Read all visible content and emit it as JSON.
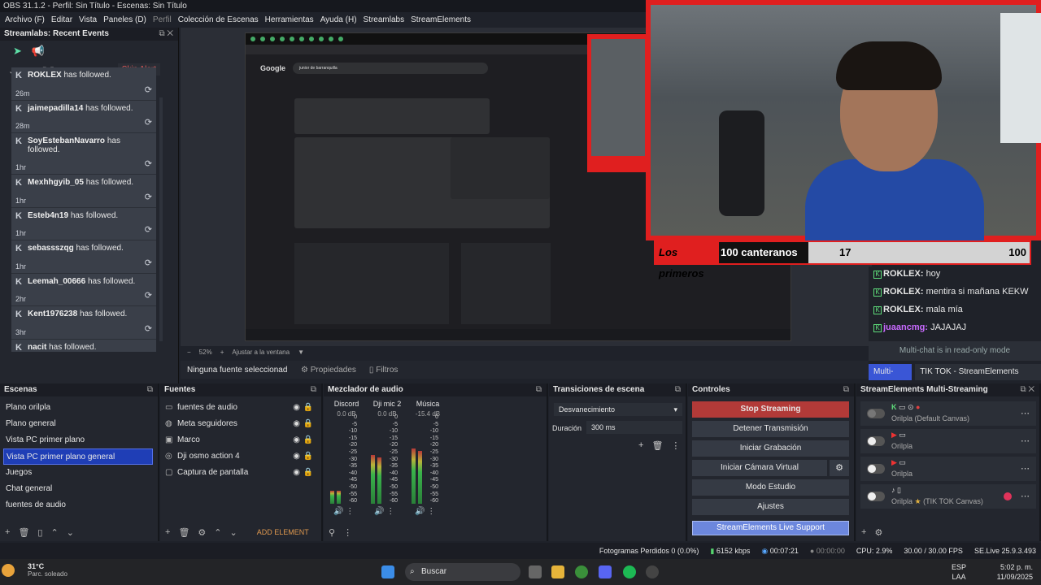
{
  "window": {
    "title": "OBS 31.1.2 - Perfil: Sin Título - Escenas: Sin Título"
  },
  "menu": [
    "Archivo (F)",
    "Editar",
    "Vista",
    "Paneles (D)",
    "Perfil",
    "Colección de Escenas",
    "Herramientas",
    "Ayuda (H)",
    "Streamlabs",
    "StreamElements"
  ],
  "events": {
    "title": "Streamlabs: Recent Events",
    "skip_label": "Skip Alert",
    "items": [
      {
        "user": "ROKLEX",
        "text": "has followed.",
        "time": "26m"
      },
      {
        "user": "jaimepadilla14",
        "text": "has followed.",
        "time": "28m"
      },
      {
        "user": "SoyEstebanNavarro",
        "text": "has followed.",
        "time": "1hr"
      },
      {
        "user": "Mexhhgyib_05",
        "text": "has followed.",
        "time": "1hr"
      },
      {
        "user": "Esteb4n19",
        "text": "has followed.",
        "time": "1hr"
      },
      {
        "user": "sebassszqg",
        "text": "has followed.",
        "time": "1hr"
      },
      {
        "user": "Leemah_00666",
        "text": "has followed.",
        "time": "2hr"
      },
      {
        "user": "Kent1976238",
        "text": "has followed.",
        "time": "3hr"
      },
      {
        "user": "nacit",
        "text": "has followed.",
        "time": ""
      }
    ]
  },
  "browser": {
    "google": "Google",
    "query": "junior de barranquilla"
  },
  "overlay": {
    "banner_red": "Los primeros",
    "banner_mid": "100 canteranos",
    "count": "17",
    "goal": "100"
  },
  "chat": {
    "messages": [
      {
        "user": "ROKLEX:",
        "text": "hoy",
        "color": "#ffffff"
      },
      {
        "user": "ROKLEX:",
        "text": "mentira si mañana KEKW",
        "color": "#ffffff"
      },
      {
        "user": "ROKLEX:",
        "text": "mala mía",
        "color": "#ffffff"
      },
      {
        "user": "juaancmg:",
        "text": "JAJAJAJ",
        "color": "#c86aff"
      }
    ],
    "readonly_note": "Multi-chat is in read-only mode",
    "tabs": [
      "Multi-Chat",
      "TIK TOK - StreamElements Canvas"
    ]
  },
  "preview": {
    "zoom": "52%",
    "fit": "Ajustar a la ventana",
    "no_source": "Ninguna fuente seleccionad",
    "props": "Propiedades",
    "filters": "Filtros"
  },
  "scenes": {
    "title": "Escenas",
    "items": [
      "Plano orilpla",
      "Plano general",
      "Vista PC primer plano",
      "Vista PC primer plano general",
      "Juegos",
      "Chat general",
      "fuentes de audio"
    ],
    "selected_index": 3
  },
  "sources": {
    "title": "Fuentes",
    "items": [
      {
        "name": "fuentes de audio",
        "icon": "folder-icon"
      },
      {
        "name": "Meta seguidores",
        "icon": "globe-icon"
      },
      {
        "name": "Marco",
        "icon": "image-icon"
      },
      {
        "name": "Dji osmo action 4",
        "icon": "camera-icon"
      },
      {
        "name": "Captura de pantalla",
        "icon": "monitor-icon"
      }
    ],
    "add_label": "ADD ELEMENT"
  },
  "mixer": {
    "title": "Mezclador de audio",
    "channels": [
      {
        "name": "Discord",
        "db": "0.0 dB",
        "level": 0.15
      },
      {
        "name": "Dji mic 2",
        "db": "0.0 dB",
        "level": 0.55
      },
      {
        "name": "Música",
        "db": "-15.4 dB",
        "level": 0.62
      }
    ],
    "ticks": [
      "0",
      "-5",
      "-10",
      "-15",
      "-20",
      "-25",
      "-30",
      "-35",
      "-40",
      "-45",
      "-50",
      "-55",
      "-60"
    ]
  },
  "transitions": {
    "title": "Transiciones de escena",
    "selected": "Desvanecimiento",
    "duration_label": "Duración",
    "duration": "300 ms"
  },
  "controls": {
    "title": "Controles",
    "buttons": [
      "Stop Streaming",
      "Detener Transmisión",
      "Iniciar Grabación",
      "Iniciar Cámara Virtual",
      "Modo Estudio",
      "Ajustes",
      "StreamElements Live Support"
    ]
  },
  "multistream": {
    "title": "StreamElements Multi-Streaming",
    "rows": [
      {
        "name": "Orilpla (Default Canvas)"
      },
      {
        "name": "Orilpla"
      },
      {
        "name": "Orilpla"
      },
      {
        "name": "Orilpla",
        "extra": "(TIK TOK Canvas)"
      }
    ]
  },
  "status": {
    "dropped": "Fotogramas Perdidos 0 (0.0%)",
    "bitrate": "6152 kbps",
    "live_time": "00:07:21",
    "rec_time": "00:00:00",
    "cpu": "CPU: 2.9%",
    "fps": "30.00 / 30.00 FPS",
    "se": "SE.Live 25.9.3.493"
  },
  "taskbar": {
    "temp": "31°C",
    "weather": "Parc. soleado",
    "search": "Buscar",
    "lang1": "ESP",
    "lang2": "LAA",
    "time": "5:02 p. m.",
    "date": "11/09/2025"
  }
}
